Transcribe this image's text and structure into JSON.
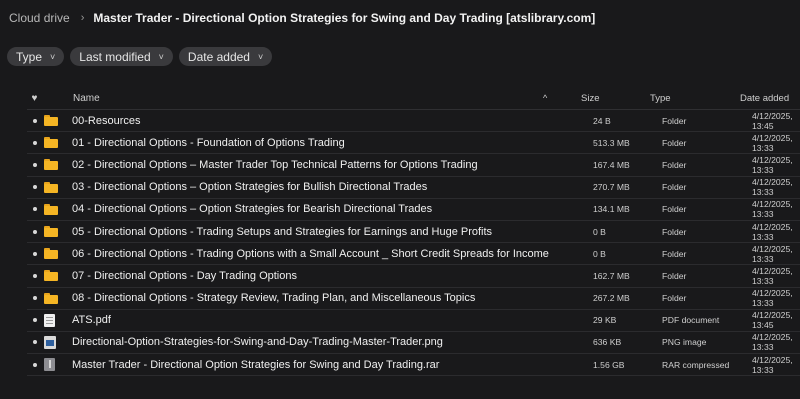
{
  "breadcrumb": {
    "root": "Cloud drive",
    "separator": "›",
    "current": "Master Trader - Directional Option Strategies for Swing and Day Trading [atslibrary.com]"
  },
  "filters": [
    {
      "label": "Type",
      "chevron": "˅"
    },
    {
      "label": "Last modified",
      "chevron": "˅"
    },
    {
      "label": "Date added",
      "chevron": "˅"
    }
  ],
  "columns": {
    "favorite": "♥",
    "name": "Name",
    "sort": "^",
    "size": "Size",
    "type": "Type",
    "date": "Date added"
  },
  "files": [
    {
      "name": "00-Resources",
      "size": "24 B",
      "type": "Folder",
      "date": "4/12/2025, 13:45",
      "icon": "folder-icon"
    },
    {
      "name": "01 - Directional Options - Foundation of Options Trading",
      "size": "513.3 MB",
      "type": "Folder",
      "date": "4/12/2025, 13:33",
      "icon": "folder-icon"
    },
    {
      "name": "02 - Directional Options – Master Trader Top Technical Patterns for Options Trading",
      "size": "167.4 MB",
      "type": "Folder",
      "date": "4/12/2025, 13:33",
      "icon": "folder-icon"
    },
    {
      "name": "03 - Directional Options – Option Strategies for Bullish Directional Trades",
      "size": "270.7 MB",
      "type": "Folder",
      "date": "4/12/2025, 13:33",
      "icon": "folder-icon"
    },
    {
      "name": "04 - Directional Options – Option Strategies for Bearish Directional Trades",
      "size": "134.1 MB",
      "type": "Folder",
      "date": "4/12/2025, 13:33",
      "icon": "folder-icon"
    },
    {
      "name": "05 - Directional Options - Trading Setups and Strategies for Earnings and Huge Profits",
      "size": "0 B",
      "type": "Folder",
      "date": "4/12/2025, 13:33",
      "icon": "folder-icon"
    },
    {
      "name": "06 - Directional Options - Trading Options with a Small Account _ Short Credit Spreads for Income",
      "size": "0 B",
      "type": "Folder",
      "date": "4/12/2025, 13:33",
      "icon": "folder-icon"
    },
    {
      "name": "07 - Directional Options - Day Trading Options",
      "size": "162.7 MB",
      "type": "Folder",
      "date": "4/12/2025, 13:33",
      "icon": "folder-icon"
    },
    {
      "name": "08 - Directional Options - Strategy Review, Trading Plan, and Miscellaneous Topics",
      "size": "267.2 MB",
      "type": "Folder",
      "date": "4/12/2025, 13:33",
      "icon": "folder-icon"
    },
    {
      "name": "ATS.pdf",
      "size": "29 KB",
      "type": "PDF document",
      "date": "4/12/2025, 13:45",
      "icon": "pdf-file-icon"
    },
    {
      "name": "Directional-Option-Strategies-for-Swing-and-Day-Trading-Master-Trader.png",
      "size": "636 KB",
      "type": "PNG image",
      "date": "4/12/2025, 13:33",
      "icon": "image-file-icon"
    },
    {
      "name": "Master Trader - Directional Option Strategies for Swing and Day Trading.rar",
      "size": "1.56 GB",
      "type": "RAR compressed",
      "date": "4/12/2025, 13:33",
      "icon": "archive-file-icon"
    }
  ]
}
